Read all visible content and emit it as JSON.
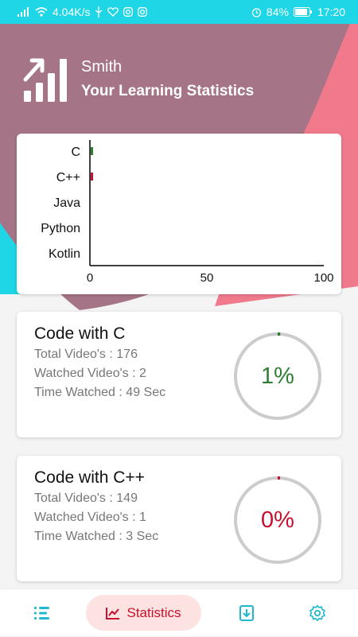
{
  "status_bar": {
    "network_speed": "4.04K/s",
    "battery": "84%",
    "time": "17:20"
  },
  "header": {
    "user_name": "Smith",
    "title": "Your Learning Statistics"
  },
  "chart_data": {
    "type": "bar",
    "orientation": "horizontal",
    "categories": [
      "C",
      "C++",
      "Java",
      "Python",
      "Kotlin"
    ],
    "values": [
      1,
      0,
      0,
      0,
      0
    ],
    "colors": [
      "#2e7d32",
      "#c8102e",
      "#2e7d32",
      "#c8102e",
      "#2e7d32"
    ],
    "xlim": [
      0,
      100
    ],
    "x_ticks": [
      "0",
      "50",
      "100"
    ],
    "grid": false
  },
  "courses": [
    {
      "title": "Code with C",
      "total_videos": "Total Video's : 176",
      "watched_videos": "Watched Video's : 2",
      "time_watched": "Time Watched : 49 Sec",
      "percent_label": "1%",
      "progress": 0.01,
      "color": "#2e7d32"
    },
    {
      "title": "Code with C++",
      "total_videos": "Total Video's : 149",
      "watched_videos": "Watched Video's : 1",
      "time_watched": "Time Watched : 3 Sec",
      "percent_label": "0%",
      "progress": 0.0,
      "color": "#c8102e"
    }
  ],
  "bottom_nav": {
    "statistics_label": "Statistics",
    "icons": [
      "list-icon",
      "chart-icon",
      "download-icon",
      "settings-icon"
    ]
  },
  "colors": {
    "accent_cyan": "#1fd6e6",
    "mauve": "#a57487",
    "pink": "#f07a8c",
    "active_red": "#c8102e",
    "green": "#2e7d32"
  }
}
